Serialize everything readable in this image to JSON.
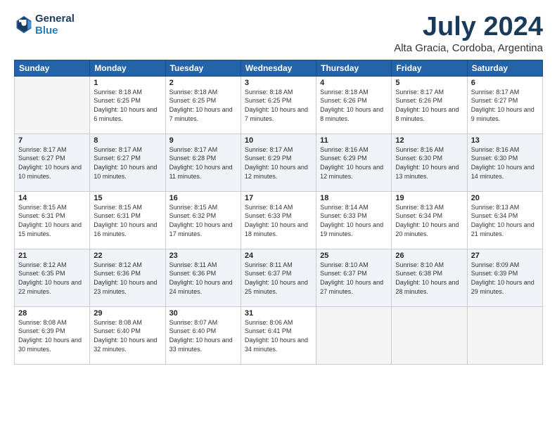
{
  "header": {
    "logo_line1": "General",
    "logo_line2": "Blue",
    "title": "July 2024",
    "subtitle": "Alta Gracia, Cordoba, Argentina"
  },
  "days_of_week": [
    "Sunday",
    "Monday",
    "Tuesday",
    "Wednesday",
    "Thursday",
    "Friday",
    "Saturday"
  ],
  "weeks": [
    [
      {
        "day": "",
        "sunrise": "",
        "sunset": "",
        "daylight": "",
        "empty": true
      },
      {
        "day": "1",
        "sunrise": "Sunrise: 8:18 AM",
        "sunset": "Sunset: 6:25 PM",
        "daylight": "Daylight: 10 hours and 6 minutes."
      },
      {
        "day": "2",
        "sunrise": "Sunrise: 8:18 AM",
        "sunset": "Sunset: 6:25 PM",
        "daylight": "Daylight: 10 hours and 7 minutes."
      },
      {
        "day": "3",
        "sunrise": "Sunrise: 8:18 AM",
        "sunset": "Sunset: 6:25 PM",
        "daylight": "Daylight: 10 hours and 7 minutes."
      },
      {
        "day": "4",
        "sunrise": "Sunrise: 8:18 AM",
        "sunset": "Sunset: 6:26 PM",
        "daylight": "Daylight: 10 hours and 8 minutes."
      },
      {
        "day": "5",
        "sunrise": "Sunrise: 8:17 AM",
        "sunset": "Sunset: 6:26 PM",
        "daylight": "Daylight: 10 hours and 8 minutes."
      },
      {
        "day": "6",
        "sunrise": "Sunrise: 8:17 AM",
        "sunset": "Sunset: 6:27 PM",
        "daylight": "Daylight: 10 hours and 9 minutes."
      }
    ],
    [
      {
        "day": "7",
        "sunrise": "Sunrise: 8:17 AM",
        "sunset": "Sunset: 6:27 PM",
        "daylight": "Daylight: 10 hours and 10 minutes."
      },
      {
        "day": "8",
        "sunrise": "Sunrise: 8:17 AM",
        "sunset": "Sunset: 6:27 PM",
        "daylight": "Daylight: 10 hours and 10 minutes."
      },
      {
        "day": "9",
        "sunrise": "Sunrise: 8:17 AM",
        "sunset": "Sunset: 6:28 PM",
        "daylight": "Daylight: 10 hours and 11 minutes."
      },
      {
        "day": "10",
        "sunrise": "Sunrise: 8:17 AM",
        "sunset": "Sunset: 6:29 PM",
        "daylight": "Daylight: 10 hours and 12 minutes."
      },
      {
        "day": "11",
        "sunrise": "Sunrise: 8:16 AM",
        "sunset": "Sunset: 6:29 PM",
        "daylight": "Daylight: 10 hours and 12 minutes."
      },
      {
        "day": "12",
        "sunrise": "Sunrise: 8:16 AM",
        "sunset": "Sunset: 6:30 PM",
        "daylight": "Daylight: 10 hours and 13 minutes."
      },
      {
        "day": "13",
        "sunrise": "Sunrise: 8:16 AM",
        "sunset": "Sunset: 6:30 PM",
        "daylight": "Daylight: 10 hours and 14 minutes."
      }
    ],
    [
      {
        "day": "14",
        "sunrise": "Sunrise: 8:15 AM",
        "sunset": "Sunset: 6:31 PM",
        "daylight": "Daylight: 10 hours and 15 minutes."
      },
      {
        "day": "15",
        "sunrise": "Sunrise: 8:15 AM",
        "sunset": "Sunset: 6:31 PM",
        "daylight": "Daylight: 10 hours and 16 minutes."
      },
      {
        "day": "16",
        "sunrise": "Sunrise: 8:15 AM",
        "sunset": "Sunset: 6:32 PM",
        "daylight": "Daylight: 10 hours and 17 minutes."
      },
      {
        "day": "17",
        "sunrise": "Sunrise: 8:14 AM",
        "sunset": "Sunset: 6:33 PM",
        "daylight": "Daylight: 10 hours and 18 minutes."
      },
      {
        "day": "18",
        "sunrise": "Sunrise: 8:14 AM",
        "sunset": "Sunset: 6:33 PM",
        "daylight": "Daylight: 10 hours and 19 minutes."
      },
      {
        "day": "19",
        "sunrise": "Sunrise: 8:13 AM",
        "sunset": "Sunset: 6:34 PM",
        "daylight": "Daylight: 10 hours and 20 minutes."
      },
      {
        "day": "20",
        "sunrise": "Sunrise: 8:13 AM",
        "sunset": "Sunset: 6:34 PM",
        "daylight": "Daylight: 10 hours and 21 minutes."
      }
    ],
    [
      {
        "day": "21",
        "sunrise": "Sunrise: 8:12 AM",
        "sunset": "Sunset: 6:35 PM",
        "daylight": "Daylight: 10 hours and 22 minutes."
      },
      {
        "day": "22",
        "sunrise": "Sunrise: 8:12 AM",
        "sunset": "Sunset: 6:36 PM",
        "daylight": "Daylight: 10 hours and 23 minutes."
      },
      {
        "day": "23",
        "sunrise": "Sunrise: 8:11 AM",
        "sunset": "Sunset: 6:36 PM",
        "daylight": "Daylight: 10 hours and 24 minutes."
      },
      {
        "day": "24",
        "sunrise": "Sunrise: 8:11 AM",
        "sunset": "Sunset: 6:37 PM",
        "daylight": "Daylight: 10 hours and 25 minutes."
      },
      {
        "day": "25",
        "sunrise": "Sunrise: 8:10 AM",
        "sunset": "Sunset: 6:37 PM",
        "daylight": "Daylight: 10 hours and 27 minutes."
      },
      {
        "day": "26",
        "sunrise": "Sunrise: 8:10 AM",
        "sunset": "Sunset: 6:38 PM",
        "daylight": "Daylight: 10 hours and 28 minutes."
      },
      {
        "day": "27",
        "sunrise": "Sunrise: 8:09 AM",
        "sunset": "Sunset: 6:39 PM",
        "daylight": "Daylight: 10 hours and 29 minutes."
      }
    ],
    [
      {
        "day": "28",
        "sunrise": "Sunrise: 8:08 AM",
        "sunset": "Sunset: 6:39 PM",
        "daylight": "Daylight: 10 hours and 30 minutes."
      },
      {
        "day": "29",
        "sunrise": "Sunrise: 8:08 AM",
        "sunset": "Sunset: 6:40 PM",
        "daylight": "Daylight: 10 hours and 32 minutes."
      },
      {
        "day": "30",
        "sunrise": "Sunrise: 8:07 AM",
        "sunset": "Sunset: 6:40 PM",
        "daylight": "Daylight: 10 hours and 33 minutes."
      },
      {
        "day": "31",
        "sunrise": "Sunrise: 8:06 AM",
        "sunset": "Sunset: 6:41 PM",
        "daylight": "Daylight: 10 hours and 34 minutes."
      },
      {
        "day": "",
        "sunrise": "",
        "sunset": "",
        "daylight": "",
        "empty": true
      },
      {
        "day": "",
        "sunrise": "",
        "sunset": "",
        "daylight": "",
        "empty": true
      },
      {
        "day": "",
        "sunrise": "",
        "sunset": "",
        "daylight": "",
        "empty": true
      }
    ]
  ]
}
